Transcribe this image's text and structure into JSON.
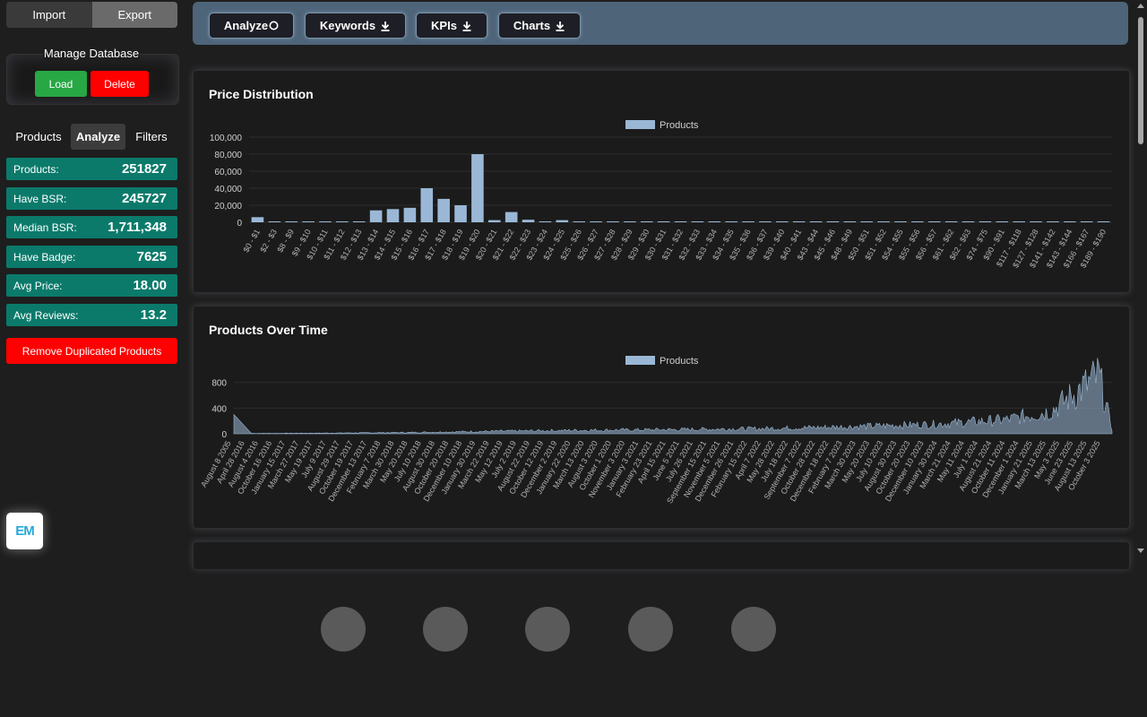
{
  "sidebar": {
    "tabs": {
      "import": "Import",
      "export": "Export"
    },
    "manage_title": "Manage Database",
    "load_label": "Load",
    "delete_label": "Delete",
    "subtabs": [
      "Products",
      "Analyze",
      "Filters"
    ],
    "stats": [
      {
        "label": "Products:",
        "value": "251827"
      },
      {
        "label": "Have BSR:",
        "value": "245727"
      },
      {
        "label": "Median BSR:",
        "value": "1,711,348"
      },
      {
        "label": "Have Badge:",
        "value": "7625"
      },
      {
        "label": "Avg Price:",
        "value": "18.00"
      },
      {
        "label": "Avg Reviews:",
        "value": "13.2"
      }
    ],
    "remove_label": "Remove Duplicated Products",
    "logo_text": "EM"
  },
  "toolbar": {
    "analyze": "Analyze",
    "keywords": "Keywords",
    "kpis": "KPIs",
    "charts": "Charts"
  },
  "panels": {
    "price": {
      "title": "Price Distribution"
    },
    "time": {
      "title": "Products Over Time"
    }
  },
  "colors": {
    "bar": "#9ab8d6",
    "stat_bg": "#0b7a6b",
    "load": "#28a745",
    "delete": "#ff0000",
    "toolbar_bg": "#4e6479"
  },
  "chart_data": [
    {
      "type": "bar",
      "title": "Price Distribution",
      "legend": "Products",
      "legend_position": "top",
      "ylim": [
        0,
        100000
      ],
      "yticks": [
        "0",
        "20,000",
        "40,000",
        "60,000",
        "80,000",
        "100,000"
      ],
      "categories": [
        "$0 - $1",
        "$2 - $3",
        "$8 - $9",
        "$9 - $10",
        "$10 - $11",
        "$11 - $12",
        "$12 - $13",
        "$13 - $14",
        "$14 - $15",
        "$15 - $16",
        "$16 - $17",
        "$17 - $18",
        "$18 - $19",
        "$19 - $20",
        "$20 - $21",
        "$21 - $22",
        "$22 - $23",
        "$23 - $24",
        "$24 - $25",
        "$25 - $26",
        "$26 - $27",
        "$27 - $28",
        "$28 - $29",
        "$29 - $30",
        "$30 - $31",
        "$31 - $32",
        "$32 - $33",
        "$33 - $34",
        "$34 - $35",
        "$35 - $36",
        "$36 - $37",
        "$39 - $40",
        "$40 - $41",
        "$43 - $44",
        "$45 - $46",
        "$48 - $49",
        "$50 - $51",
        "$51 - $52",
        "$54 - $55",
        "$55 - $56",
        "$56 - $57",
        "$61 - $62",
        "$62 - $63",
        "$74 - $75",
        "$90 - $91",
        "$117 - $118",
        "$127 - $128",
        "$141 - $142",
        "$143 - $144",
        "$166 - $167",
        "$189 - $190"
      ],
      "values": [
        6000,
        500,
        300,
        300,
        400,
        300,
        500,
        14000,
        15500,
        17000,
        40000,
        27500,
        20000,
        80000,
        2500,
        12000,
        3000,
        1000,
        2500,
        500,
        300,
        300,
        200,
        300,
        200,
        200,
        200,
        200,
        200,
        200,
        200,
        200,
        200,
        200,
        200,
        200,
        200,
        200,
        200,
        200,
        200,
        200,
        200,
        200,
        200,
        200,
        200,
        200,
        200,
        200,
        200
      ],
      "grid": true
    },
    {
      "type": "area",
      "title": "Products Over Time",
      "legend": "Products",
      "legend_position": "top",
      "ylim": [
        0,
        950
      ],
      "yticks": [
        "0",
        "400",
        "800"
      ],
      "x_start": "August 8 2005",
      "x_end": "October 31 2025",
      "x_tick_labels": [
        "August 8 2005",
        "April 28 2016",
        "August 4 2016",
        "October 16 2016",
        "January 15 2017",
        "March 27 2017",
        "May 19 2017",
        "July 9 2017",
        "August 29 2017",
        "October 19 2017",
        "December 13 2017",
        "February 7 2018",
        "March 30 2018",
        "May 20 2018",
        "July 10 2018",
        "August 30 2018",
        "October 20 2018",
        "December 10 2018",
        "January 30 2019",
        "March 22 2019",
        "May 12 2019",
        "July 2 2019",
        "August 22 2019",
        "October 12 2019",
        "December 2 2019",
        "January 22 2020",
        "March 13 2020",
        "August 3 2020",
        "October 1 2020",
        "November 3 2020",
        "January 3 2021",
        "February 23 2021",
        "April 15 2021",
        "June 5 2021",
        "July 26 2021",
        "September 15 2021",
        "November 5 2021",
        "December 26 2021",
        "February 15 2022",
        "April 7 2022",
        "May 28 2022",
        "July 18 2022",
        "September 7 2022",
        "October 28 2022",
        "December 18 2022",
        "February 7 2023",
        "March 30 2023",
        "May 20 2023",
        "July 10 2023",
        "August 30 2023",
        "October 20 2023",
        "December 10 2023",
        "January 30 2024",
        "March 21 2024",
        "May 11 2024",
        "July 1 2024",
        "August 21 2024",
        "October 11 2024",
        "December 1 2024",
        "January 21 2025",
        "March 13 2025",
        "May 3 2025",
        "June 23 2025",
        "August 13 2025",
        "October 3 2025"
      ],
      "profile": [
        {
          "frac": 0.0,
          "value": 300
        },
        {
          "frac": 0.02,
          "value": 5
        },
        {
          "frac": 0.1,
          "value": 10
        },
        {
          "frac": 0.2,
          "value": 20
        },
        {
          "frac": 0.3,
          "value": 40
        },
        {
          "frac": 0.4,
          "value": 55
        },
        {
          "frac": 0.5,
          "value": 65
        },
        {
          "frac": 0.6,
          "value": 80
        },
        {
          "frac": 0.7,
          "value": 110
        },
        {
          "frac": 0.8,
          "value": 150
        },
        {
          "frac": 0.88,
          "value": 220
        },
        {
          "frac": 0.93,
          "value": 350
        },
        {
          "frac": 0.96,
          "value": 650
        },
        {
          "frac": 0.985,
          "value": 900
        },
        {
          "frac": 1.0,
          "value": 60
        }
      ]
    }
  ]
}
